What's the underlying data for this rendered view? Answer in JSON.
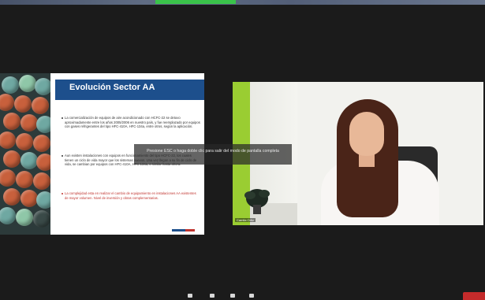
{
  "slide": {
    "title": "Evolución Sector AA",
    "bullets": [
      "La comercialización de equipos de aire acondicionado con HCFC-22 se detuvo aproximadamente entre los años 2005/2006 en nuestro país, y fue reemplazado por equipos con gases refrigerantes del tipo HFC-410A, HFC-134a, entre otros, según la aplicación.",
      "Aun existen instalaciones con equipos en funcionamiento del tipo HCFC-22, los cuales tienen un ciclo de vida mayor que los sistemas nuevos. Una vez llegan a su fin de ciclo de vida, se cambian por equipos con HFC-410A, HFC-134a, o similar hasta ahora.",
      "La complejidad esta en realizar el cambio de equipamiento en instalaciones AA existentes de mayor volumen. Nivel de inversión y obras complementarias."
    ]
  },
  "overlay": {
    "fullscreen_notice": "Presione ESC o haga doble clic para salir del modo de pantalla completa"
  },
  "video": {
    "participant_name": "Camila Ortiz"
  },
  "colors": {
    "slide_header": "#1d4f8c",
    "highlight_red": "#c0342f",
    "wall_green": "#9acd32",
    "end_button": "#c42b2b",
    "top_indicator": "#3ac34a"
  },
  "icons": [
    "mic-icon",
    "camera-icon",
    "participants-icon",
    "share-icon"
  ]
}
